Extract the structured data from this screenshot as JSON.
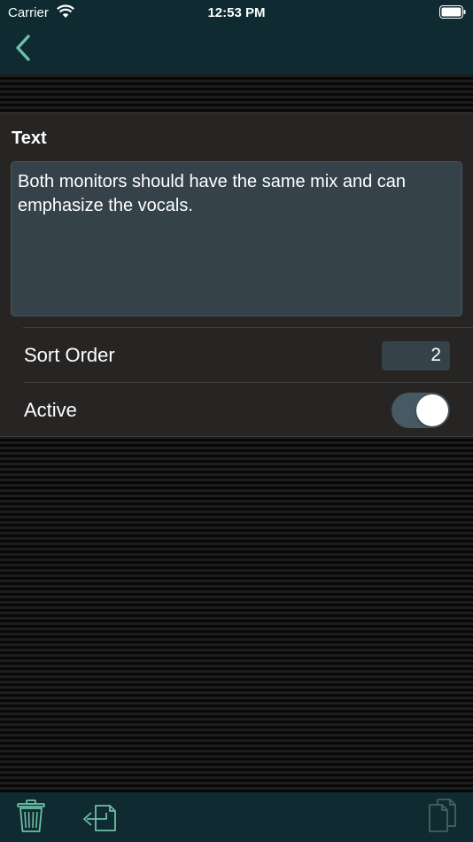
{
  "status_bar": {
    "carrier": "Carrier",
    "time": "12:53 PM"
  },
  "nav": {
    "back_icon": "chevron-left-icon"
  },
  "form": {
    "text_label": "Text",
    "text_value": "Both monitors should have the same mix and can emphasize the vocals.",
    "sort_order_label": "Sort Order",
    "sort_order_value": "2",
    "active_label": "Active",
    "active_on": true
  },
  "toolbar": {
    "icons": [
      "trash-icon",
      "export-icon",
      "duplicate-icon"
    ]
  },
  "colors": {
    "bar_background": "#0f2a31",
    "accent": "#6fbfa6",
    "card_background": "#272424",
    "field_background": "#35424a"
  }
}
